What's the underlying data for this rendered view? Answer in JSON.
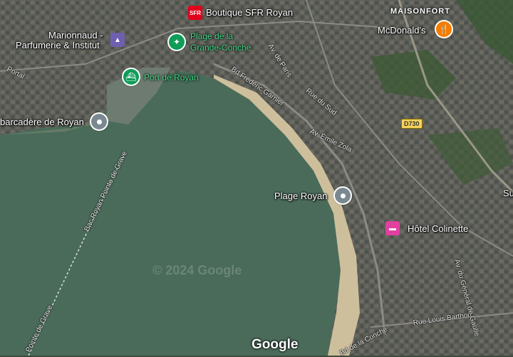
{
  "map": {
    "district": "MAISONFORT",
    "pois": {
      "sfr": {
        "badge": "SFR",
        "label": "Boutique SFR Royan"
      },
      "marionnaud": {
        "label_line1": "Marionnaud -",
        "label_line2": "Parfumerie & Institut"
      },
      "beach_gc": {
        "label_line1": "Plage de la",
        "label_line2": "Grande-Conche"
      },
      "mcdonalds": {
        "label": "McDonald's"
      },
      "port": {
        "label": "Port de Royan"
      },
      "embarcadere": {
        "label": "barcadère de Royan"
      },
      "plage_royan": {
        "label": "Plage Royan"
      },
      "hotel": {
        "label": "Hôtel Colinette"
      }
    },
    "roads": {
      "d730": "D730",
      "bd_frederic_garnier": "Bd Frédéric Garnier",
      "av_de_paris": "Av. de Paris",
      "rue_du_sud": "Rue du Sud",
      "av_emile_zola": "Av. Émile Zola",
      "bac": "Bac Royan Pointe de Grave",
      "pointe_de_grave": "Pointe de Grave",
      "rue_louis_barthou": "Rue Louis Barthou",
      "bd_grande_conche": "Bd de la Conche",
      "av_charles_de_gaulle": "Av. du Général de Gaulle",
      "portal": "Portal",
      "su": "Su"
    },
    "colors": {
      "water": "#4a6b5a",
      "sand": "#cdbf9c",
      "urban": "#5b5e58",
      "vegetation": "#3d5a36",
      "poi_green": "#0f9d58",
      "poi_gray": "#7a8890",
      "fastfood": "#f57c00",
      "hotel": "#e040a0",
      "sfr": "#e2001a",
      "marionnaud": "#6f5fb0"
    },
    "watermark": "© 2024 Google",
    "logo": "Google"
  }
}
